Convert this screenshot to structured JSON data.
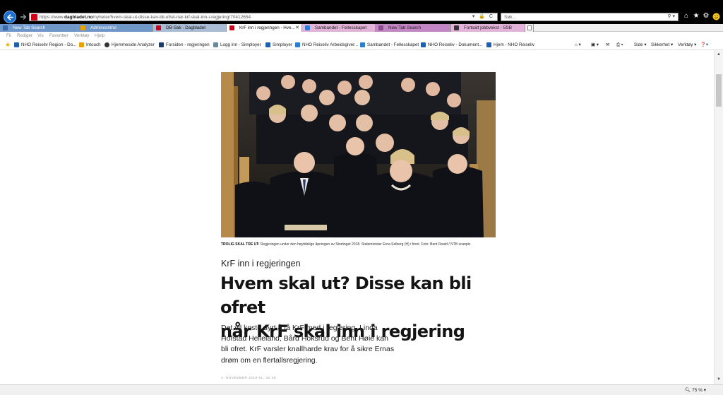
{
  "browser": {
    "url_prefix": "https://www.",
    "url_domain": "dagbladet.no",
    "url_path": "/nyheter/hvem-skal-ut-disse-kan-bli-ofret-nar-krf-skal-inn-i-regjering/70412654",
    "addr_icons": "▾ 🔒 C",
    "search_placeholder": "Søk...",
    "search_icons": "⚲ ▾"
  },
  "tabs": [
    {
      "label": "New Tab Search",
      "color": "#6f98c9"
    },
    {
      "label": "Admincontrol",
      "color": "#6f98c9"
    },
    {
      "label": "DB-Sak - Dagbladet",
      "color": "#a9bcd6"
    },
    {
      "label": "KrF inn i regjeringen - Hve...",
      "color": "#ffffff",
      "close": "✕"
    },
    {
      "label": "Sambandet - Fellesskapet",
      "color": "#e3b2d9"
    },
    {
      "label": "New Tab Search",
      "color": "#c386c5"
    },
    {
      "label": "Fortsatt jobbvekst - SSB",
      "color": "#e3b2d9"
    }
  ],
  "menu": [
    "Fil",
    "Rediger",
    "Vis",
    "Favoritter",
    "Verktøy",
    "Hjelp"
  ],
  "favorites": [
    {
      "label": "NHO Reiseliv Region - Do...",
      "color": "#1f5fad"
    },
    {
      "label": "Intouch",
      "color": "#e8a200"
    },
    {
      "label": "Hjemmeside Analyzer",
      "color": "#333333"
    },
    {
      "label": "Forsiden - regjeringen",
      "color": "#1a3b6e"
    },
    {
      "label": "Logg inn - Simployer",
      "color": "#6a8a9f"
    },
    {
      "label": "Simployer",
      "color": "#1f5fad"
    },
    {
      "label": "NHO Reiseliv Arbeidsgiver...",
      "color": "#2a7fd4"
    },
    {
      "label": "Sambandet - Fellesskapet",
      "color": "#2a7fd4"
    },
    {
      "label": "NHO Reiseliv - Dokument...",
      "color": "#1f5fad"
    },
    {
      "label": "Hjem - NHO Reiseliv",
      "color": "#1f5fad"
    }
  ],
  "commandbar": {
    "side": "Side ▾",
    "sikkerhet": "Sikkerhet ▾",
    "verktoy": "Verktøy ▾"
  },
  "article": {
    "caption_bold": "TROLIG SKAL TRE UT:",
    "caption_text": "Regjeringen under den høytidelige åpningen av Stortinget 2018. Statsminister Erna Solberg (H) i front. Foto: Bent Roald / NTB scanpix",
    "kicker": "KrF inn i regjeringen",
    "headline_line1": "Hvem skal ut? Disse kan bli ofret",
    "headline_line2": "når KrF skal inn i regjering",
    "lead": "Det vil koste dyrt å få KrF med i regjering. Linda Hofstad Helleland, Bård Hoksrud og Bent Høie kan bli ofret. KrF varsler knallharde krav for å sikre Ernas drøm om en flertallsregjering.",
    "dateline": "4. NOVEMBER 2018 KL. 20.48"
  },
  "status": {
    "zoom": "75 %"
  }
}
